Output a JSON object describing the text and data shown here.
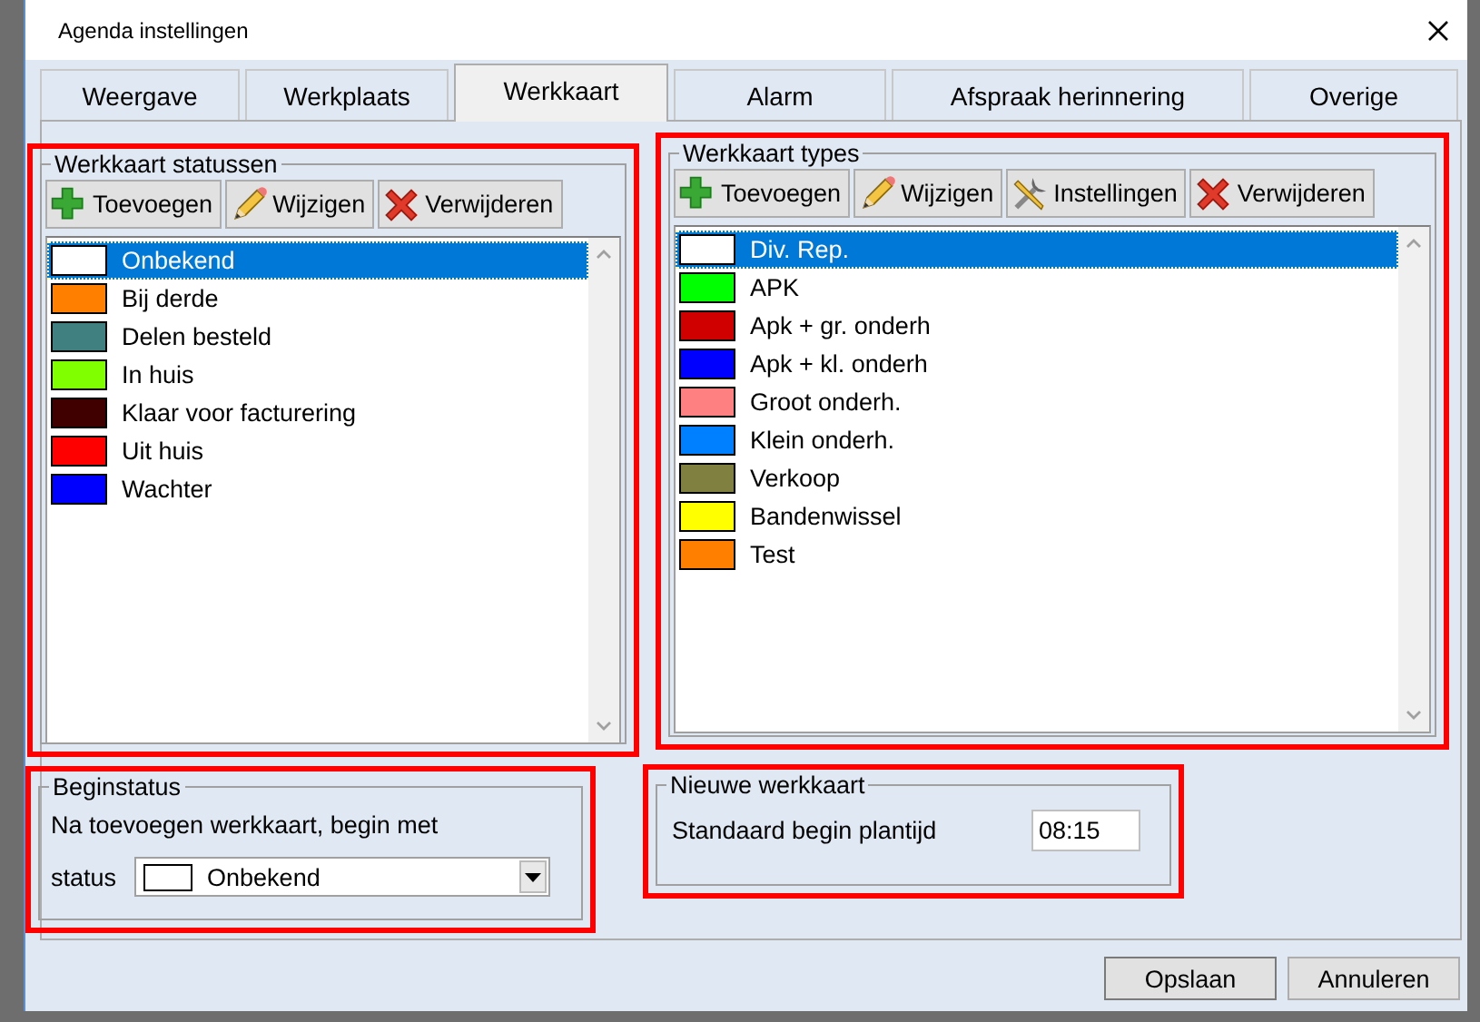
{
  "window": {
    "title": "Agenda instellingen"
  },
  "tabs": [
    {
      "label": "Weergave",
      "selected": false
    },
    {
      "label": "Werkplaats",
      "selected": false
    },
    {
      "label": "Werkkaart",
      "selected": true
    },
    {
      "label": "Alarm",
      "selected": false
    },
    {
      "label": "Afspraak herinnering",
      "selected": false
    },
    {
      "label": "Overige",
      "selected": false
    }
  ],
  "status_group": {
    "title": "Werkkaart statussen",
    "highlighted": true,
    "buttons": [
      {
        "label": "Toevoegen",
        "kind": "add"
      },
      {
        "label": "Wijzigen",
        "kind": "edit"
      },
      {
        "label": "Verwijderen",
        "kind": "delete"
      }
    ],
    "items": [
      {
        "label": "Onbekend",
        "color": "#ffffff",
        "selected": true
      },
      {
        "label": "Bij derde",
        "color": "#ff8000",
        "selected": false
      },
      {
        "label": "Delen besteld",
        "color": "#408080",
        "selected": false
      },
      {
        "label": "In huis",
        "color": "#80ff00",
        "selected": false
      },
      {
        "label": "Klaar voor facturering",
        "color": "#400000",
        "selected": false
      },
      {
        "label": "Uit huis",
        "color": "#ff0000",
        "selected": false
      },
      {
        "label": "Wachter",
        "color": "#0000ff",
        "selected": false
      }
    ]
  },
  "types_group": {
    "title": "Werkkaart types",
    "highlighted": true,
    "buttons": [
      {
        "label": "Toevoegen",
        "kind": "add"
      },
      {
        "label": "Wijzigen",
        "kind": "edit"
      },
      {
        "label": "Instellingen",
        "kind": "settings"
      },
      {
        "label": "Verwijderen",
        "kind": "delete"
      }
    ],
    "items": [
      {
        "label": "Div. Rep.",
        "color": "#ffffff",
        "selected": true
      },
      {
        "label": "APK",
        "color": "#00ff00",
        "selected": false
      },
      {
        "label": "Apk + gr. onderh",
        "color": "#d00000",
        "selected": false
      },
      {
        "label": "Apk + kl. onderh",
        "color": "#0000ff",
        "selected": false
      },
      {
        "label": "Groot onderh.",
        "color": "#ff8080",
        "selected": false
      },
      {
        "label": "Klein onderh.",
        "color": "#0080ff",
        "selected": false
      },
      {
        "label": "Verkoop",
        "color": "#808040",
        "selected": false
      },
      {
        "label": "Bandenwissel",
        "color": "#ffff00",
        "selected": false
      },
      {
        "label": "Test",
        "color": "#ff8000",
        "selected": false
      }
    ]
  },
  "begin_group": {
    "title": "Beginstatus",
    "highlighted": true,
    "text": "Na toevoegen werkkaart, begin met",
    "field_label": "status",
    "dropdown": {
      "value": "Onbekend",
      "color": "#ffffff"
    }
  },
  "new_group": {
    "title": "Nieuwe werkkaart",
    "highlighted": true,
    "field_label": "Standaard begin plantijd",
    "time_value": "08:15"
  },
  "buttons": [
    "Opslaan",
    "Annuleren"
  ]
}
